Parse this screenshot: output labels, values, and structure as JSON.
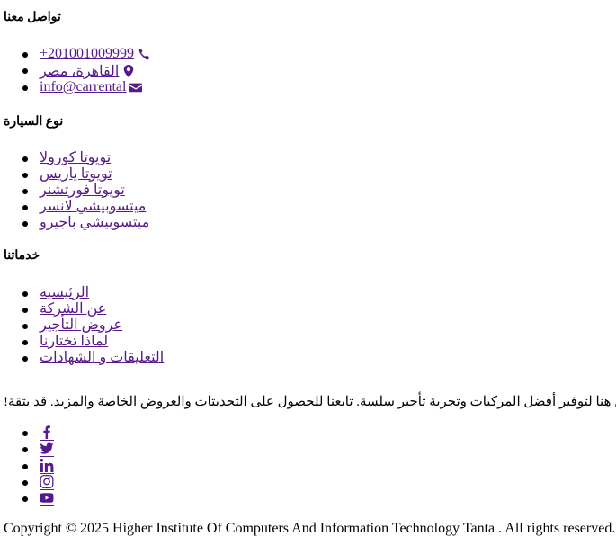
{
  "contact": {
    "heading": "تواصل معنا",
    "phone": "+201001009999",
    "location": "القاهرة، مصر",
    "email": "info@carrental"
  },
  "car_types": {
    "heading": "نوع السيارة",
    "items": [
      "تويوتا كورولا",
      "تويوتا ياريس",
      "تويوتا فورتشنر",
      "ميتسوبيشي لانسر",
      "ميتسوبيشي باجيرو"
    ]
  },
  "services": {
    "heading": "خدماتنا",
    "items": [
      "الرئيسية",
      "عن الشركة",
      "عروض التأجير",
      "لماذا تختارنا",
      "التعليقات و الشهادات"
    ]
  },
  "about": {
    "text": "نحن هنا لتوفير أفضل المركبات وتجربة تأجير سلسة. تابعنا للحصول على التحديثات والعروض الخاصة والمزيد. قد بثقة!"
  },
  "social": {
    "icons": [
      "facebook-icon",
      "twitter-icon",
      "linkedin-icon",
      "instagram-icon",
      "youtube-icon"
    ]
  },
  "footer": {
    "copyright": "Copyright © 2025 Higher Institute Of Computers And Information Technology Tanta . All rights reserved."
  },
  "colors": {
    "link": "#551a8b",
    "text": "#000000",
    "background": "#ffffff"
  }
}
